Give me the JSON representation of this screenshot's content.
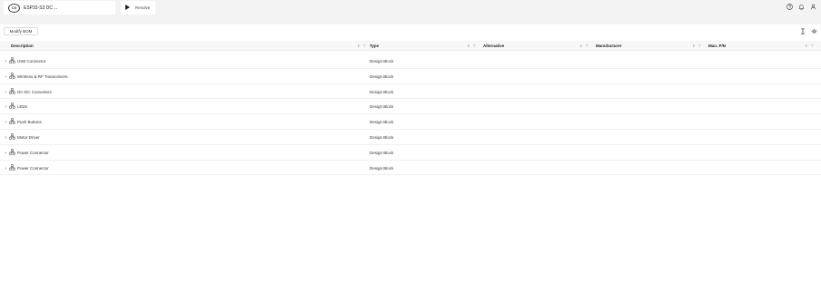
{
  "app": {
    "logo_text": "CS",
    "project_name": "ESP32-S3 DC ...",
    "resolve_label": "Resolve"
  },
  "top_icons": [
    "help-icon",
    "bell-icon",
    "user-icon"
  ],
  "toolbar": {
    "modify_label": "Modify BOM"
  },
  "table": {
    "columns": [
      "Description",
      "Type",
      "Alternative",
      "Manufacturer",
      "Man. P/N"
    ],
    "rows": [
      {
        "description": "USB Connector",
        "type": "Design Block"
      },
      {
        "description": "Wireless & RF Transceivers",
        "type": "Design Block"
      },
      {
        "description": "DC-DC Converters",
        "type": "Design Block"
      },
      {
        "description": "LEDs",
        "type": "Design Block"
      },
      {
        "description": "Push Buttons",
        "type": "Design Block"
      },
      {
        "description": "Motor Driver",
        "type": "Design Block"
      },
      {
        "description": "Power Connector",
        "type": "Design Block"
      },
      {
        "description": "Power Connector",
        "type": "Design Block"
      }
    ]
  },
  "colors": {
    "topbar_bg": "#f3f3f3",
    "header_bg": "#f7f7f7",
    "text": "#2b2b2b"
  }
}
